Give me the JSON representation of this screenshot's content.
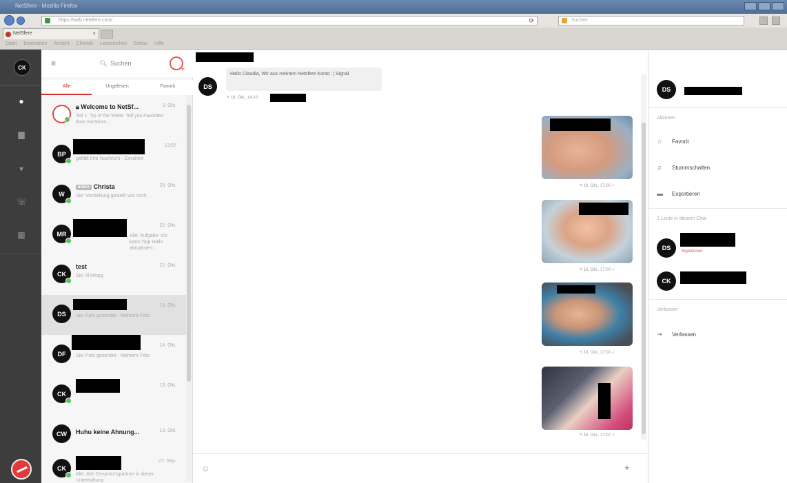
{
  "browser": {
    "title": "NetSfere - Mozilla Firefox",
    "url": "https://web.netsfere.com/",
    "search_placeholder": "Suchen",
    "tab_label": "NetSfere",
    "menu": [
      "Datei",
      "Bearbeiten",
      "Ansicht",
      "Chronik",
      "Lesezeichen",
      "Extras",
      "Hilfe"
    ]
  },
  "rail": {
    "me_initials": "CK",
    "icons": [
      "chat-icon",
      "contacts-icon",
      "broadcast-icon",
      "phone-icon",
      "calendar-icon"
    ]
  },
  "list": {
    "search_placeholder": "Suchen",
    "filters": [
      "Alle",
      "Ungelesen",
      "Favorit"
    ],
    "rows": [
      {
        "initials": "",
        "name": "Welcome to NetSf...",
        "time": "3. Okt.",
        "preview": "Teil 1: Tip of the Week: Tell you Favoriten Ihrer NetSfere...",
        "locked": true
      },
      {
        "initials": "BP",
        "name": "",
        "time": "13:07",
        "preview": "gefällt Ihre Nachricht - Gerahmt",
        "locked": false
      },
      {
        "initials": "W",
        "name": "Christa",
        "time": "20. Okt.",
        "preview": "Sie: Vorstellung gestellt von mich",
        "locked": false,
        "badge": "Intern"
      },
      {
        "initials": "MR",
        "name": "",
        "time": "22. Okt.",
        "preview": "Alle: Aufgabe: Ich kann Tipp Hallo aktualisiert...",
        "locked": false
      },
      {
        "initials": "CK",
        "name": "test",
        "time": "22. Okt.",
        "preview": "Sie: Ill Hmpg",
        "locked": false
      },
      {
        "initials": "DS",
        "name": "",
        "time": "16. Okt.",
        "preview": "Sie: Foto gesendet - Mehrere Foto",
        "locked": false
      },
      {
        "initials": "DF",
        "name": "",
        "time": "14. Okt.",
        "preview": "Sie: Foto gesendet - Mehrere Foto",
        "locked": false
      },
      {
        "initials": "CK",
        "name": "",
        "time": "13. Okt.",
        "preview": "",
        "locked": false
      },
      {
        "initials": "CW",
        "name": "Huhu keine Ahnung...",
        "time": "13. Okt.",
        "preview": "",
        "locked": false
      },
      {
        "initials": "CK",
        "name": "",
        "time": "27. Sep.",
        "preview": "Alle: Alle Gesprächspartner in dieser Unterhaltung",
        "locked": false
      }
    ]
  },
  "chat": {
    "incoming": {
      "initials": "DS",
      "text": "Hallo Claudia, Wir aus meinem Netsfere Konto :) Signal",
      "meta": "16. Okt., 14:10"
    },
    "photos": [
      {
        "meta": "16. Okt., 17:00"
      },
      {
        "meta": "16. Okt., 17:00"
      },
      {
        "meta": "16. Okt., 17:00"
      },
      {
        "meta": "16. Okt., 17:00"
      }
    ],
    "composer": {
      "emoji_icon": "emoji-icon",
      "attach_icon": "plus-icon"
    }
  },
  "detail": {
    "header_initials": "DS",
    "section_actions": "Aktionen",
    "actions": [
      "Favorit",
      "Stummschalten",
      "Exportieren"
    ],
    "members_title": "2 Leute in diesem Chat",
    "members": [
      {
        "initials": "DS",
        "role": "Eigentümer"
      },
      {
        "initials": "CK",
        "role": ""
      }
    ],
    "leave_section": "Verlassen",
    "leave_label": "Verlassen"
  },
  "colors": {
    "accent": "#cc3333",
    "rail": "#3d3d3d",
    "online": "#5fc05f"
  }
}
